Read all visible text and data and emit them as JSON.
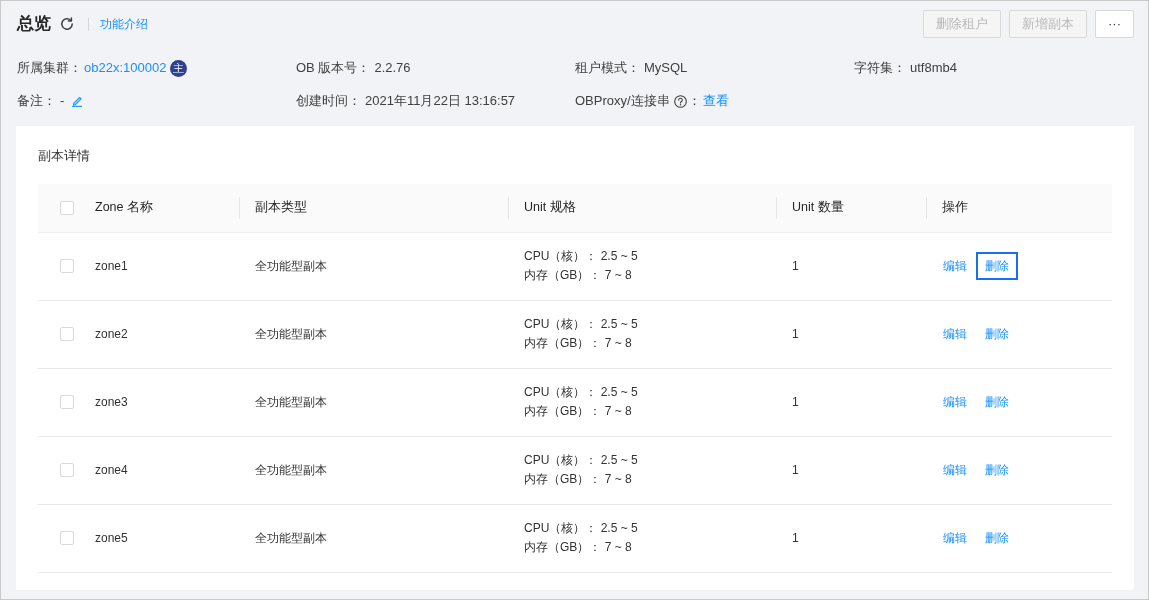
{
  "header": {
    "title": "总览",
    "intro_link": "功能介绍",
    "buttons": [
      {
        "label": "删除租户",
        "kind": "action",
        "disabled": true
      },
      {
        "label": "新增副本",
        "kind": "action",
        "disabled": true
      },
      {
        "label": "···",
        "kind": "more",
        "disabled": false
      }
    ]
  },
  "info": {
    "rows": [
      [
        {
          "kind": "link",
          "label": "所属集群：",
          "value": "ob22x:100002",
          "badge": "主"
        },
        {
          "kind": "text",
          "label": "OB 版本号：",
          "value": "2.2.76"
        },
        {
          "kind": "text",
          "label": "租户模式：",
          "value": "MySQL"
        },
        {
          "kind": "text",
          "label": "字符集：",
          "value": "utf8mb4"
        }
      ],
      [
        {
          "kind": "text",
          "label": "备注：",
          "value": "-",
          "editable": true
        },
        {
          "kind": "text",
          "label": "创建时间：",
          "value": "2021年11月22日 13:16:57"
        },
        {
          "kind": "link",
          "label": "OBProxy/连接串",
          "help": true,
          "label_suffix": "：",
          "value": "查看"
        }
      ]
    ]
  },
  "replicas": {
    "title": "副本详情",
    "select_all": {
      "checked": false
    },
    "columns": [
      "Zone 名称",
      "副本类型",
      "Unit 规格",
      "Unit 数量",
      "操作"
    ],
    "rows": [
      {
        "checked": false,
        "zone": "zone1",
        "type": "全功能型副本",
        "unit_spec": [
          "CPU（核）： 2.5 ~ 5",
          "内存（GB）： 7 ~ 8"
        ],
        "unit_count": "1",
        "actions": [
          {
            "label": "编辑",
            "focused": false
          },
          {
            "label": "删除",
            "focused": true
          }
        ]
      },
      {
        "checked": false,
        "zone": "zone2",
        "type": "全功能型副本",
        "unit_spec": [
          "CPU（核）： 2.5 ~ 5",
          "内存（GB）： 7 ~ 8"
        ],
        "unit_count": "1",
        "actions": [
          {
            "label": "编辑",
            "focused": false
          },
          {
            "label": "删除",
            "focused": false
          }
        ]
      },
      {
        "checked": false,
        "zone": "zone3",
        "type": "全功能型副本",
        "unit_spec": [
          "CPU（核）： 2.5 ~ 5",
          "内存（GB）： 7 ~ 8"
        ],
        "unit_count": "1",
        "actions": [
          {
            "label": "编辑",
            "focused": false
          },
          {
            "label": "删除",
            "focused": false
          }
        ]
      },
      {
        "checked": false,
        "zone": "zone4",
        "type": "全功能型副本",
        "unit_spec": [
          "CPU（核）： 2.5 ~ 5",
          "内存（GB）： 7 ~ 8"
        ],
        "unit_count": "1",
        "actions": [
          {
            "label": "编辑",
            "focused": false
          },
          {
            "label": "删除",
            "focused": false
          }
        ]
      },
      {
        "checked": false,
        "zone": "zone5",
        "type": "全功能型副本",
        "unit_spec": [
          "CPU（核）： 2.5 ~ 5",
          "内存（GB）： 7 ~ 8"
        ],
        "unit_count": "1",
        "actions": [
          {
            "label": "编辑",
            "focused": false
          },
          {
            "label": "删除",
            "focused": false
          }
        ]
      }
    ]
  }
}
